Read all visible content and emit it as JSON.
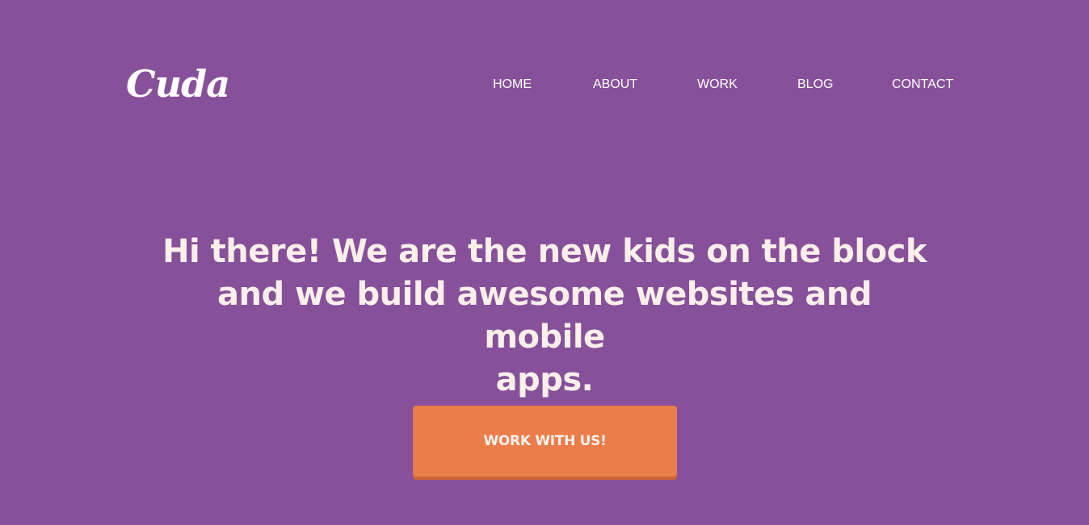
{
  "header": {
    "logo_text": "Cuda",
    "nav": [
      {
        "label": "HOME"
      },
      {
        "label": "ABOUT"
      },
      {
        "label": "WORK"
      },
      {
        "label": "BLOG"
      },
      {
        "label": "CONTACT"
      }
    ]
  },
  "hero": {
    "headline_line1": "Hi there! We are the new kids on the block",
    "headline_line2": "and we build awesome websites and mobile",
    "headline_line3": "apps.",
    "cta_label": "WORK WITH US!"
  },
  "colors": {
    "background": "#87509a",
    "cta_background": "#eb7d4b",
    "headline_text": "#fbefe9"
  }
}
